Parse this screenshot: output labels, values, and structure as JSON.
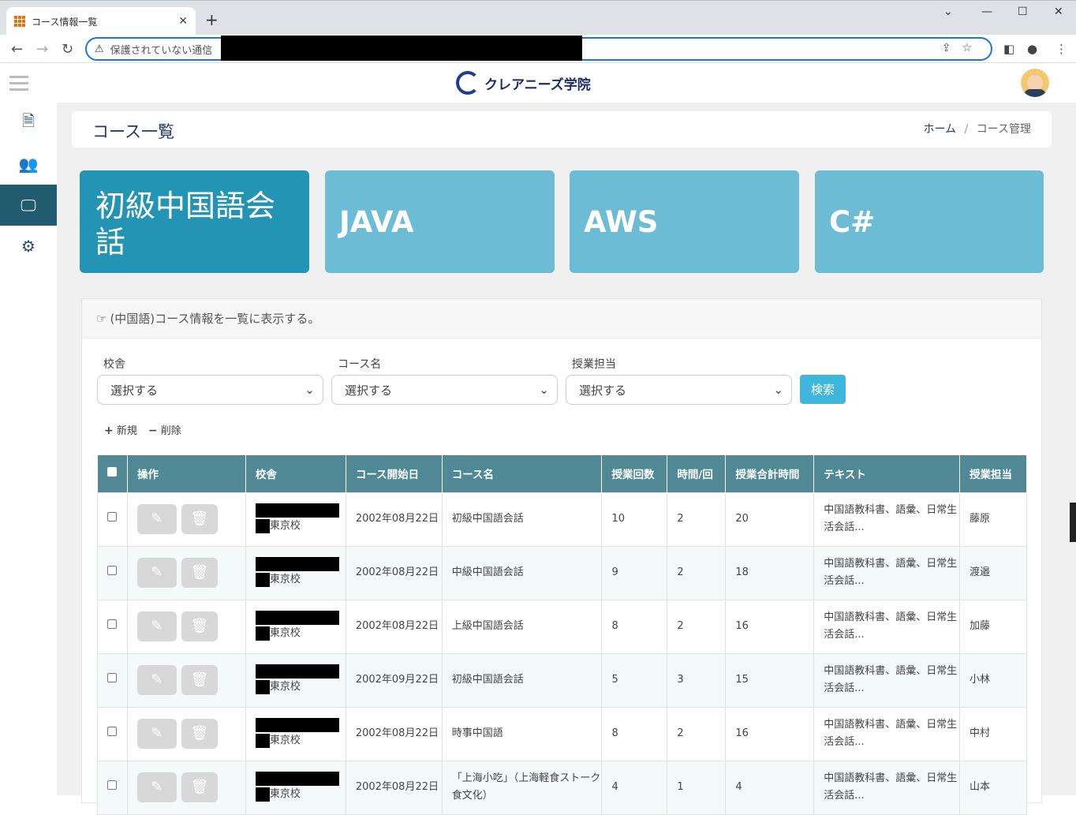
{
  "browser": {
    "tab_title": "コース情報一覧",
    "address_warning": "保護されていない通信"
  },
  "app": {
    "brand": "クレアニーズ学院"
  },
  "header": {
    "title": "コース一覧",
    "breadcrumb_home": "ホーム",
    "breadcrumb_sep": "/",
    "breadcrumb_current": "コース管理"
  },
  "courses": [
    {
      "label": "初級中国語会話"
    },
    {
      "label": "JAVA"
    },
    {
      "label": "AWS"
    },
    {
      "label": "C#"
    }
  ],
  "panel": {
    "heading": "(中国語)コース情報を一覧に表示する。",
    "filters": [
      {
        "label": "校舎",
        "value": "選択する"
      },
      {
        "label": "コース名",
        "value": "選択する"
      },
      {
        "label": "授業担当",
        "value": "選択する"
      }
    ],
    "search_button": "検索",
    "new_label": "新規",
    "delete_label": "削除"
  },
  "table": {
    "headers": [
      "操作",
      "校舎",
      "コース開始日",
      "コース名",
      "授業回数",
      "時間/回",
      "授業合計時間",
      "テキスト",
      "授業担当"
    ],
    "rows": [
      {
        "school": "東京校",
        "start": "2002年08月22日",
        "name": "初級中国語会話",
        "count": "10",
        "hours": "2",
        "total": "20",
        "text": "中国語教科書、語彙、日常生活会話...",
        "teacher": "藤原"
      },
      {
        "school": "東京校",
        "start": "2002年08月22日",
        "name": "中級中国語会話",
        "count": "9",
        "hours": "2",
        "total": "18",
        "text": "中国語教科書、語彙、日常生活会話...",
        "teacher": "渡邉"
      },
      {
        "school": "東京校",
        "start": "2002年08月22日",
        "name": "上級中国語会話",
        "count": "8",
        "hours": "2",
        "total": "16",
        "text": "中国語教科書、語彙、日常生活会話...",
        "teacher": "加藤"
      },
      {
        "school": "東京校",
        "start": "2002年09月22日",
        "name": "初級中国語会話",
        "count": "5",
        "hours": "3",
        "total": "15",
        "text": "中国語教科書、語彙、日常生活会話...",
        "teacher": "小林"
      },
      {
        "school": "東京校",
        "start": "2002年08月22日",
        "name": "時事中国語",
        "count": "8",
        "hours": "2",
        "total": "16",
        "text": "中国語教科書、語彙、日常生活会話...",
        "teacher": "中村"
      },
      {
        "school": "東京校",
        "start": "2002年08月22日",
        "name": "「上海小吃」（上海軽食ストーク食文化）",
        "count": "4",
        "hours": "1",
        "total": "4",
        "text": "中国語教科書、語彙、日常生活会話...",
        "teacher": "山本"
      }
    ]
  },
  "colors": {
    "active_card": "#2494b5",
    "card": "#6cbcd6",
    "table_header": "#508896",
    "sidebar_active": "#205b70"
  }
}
